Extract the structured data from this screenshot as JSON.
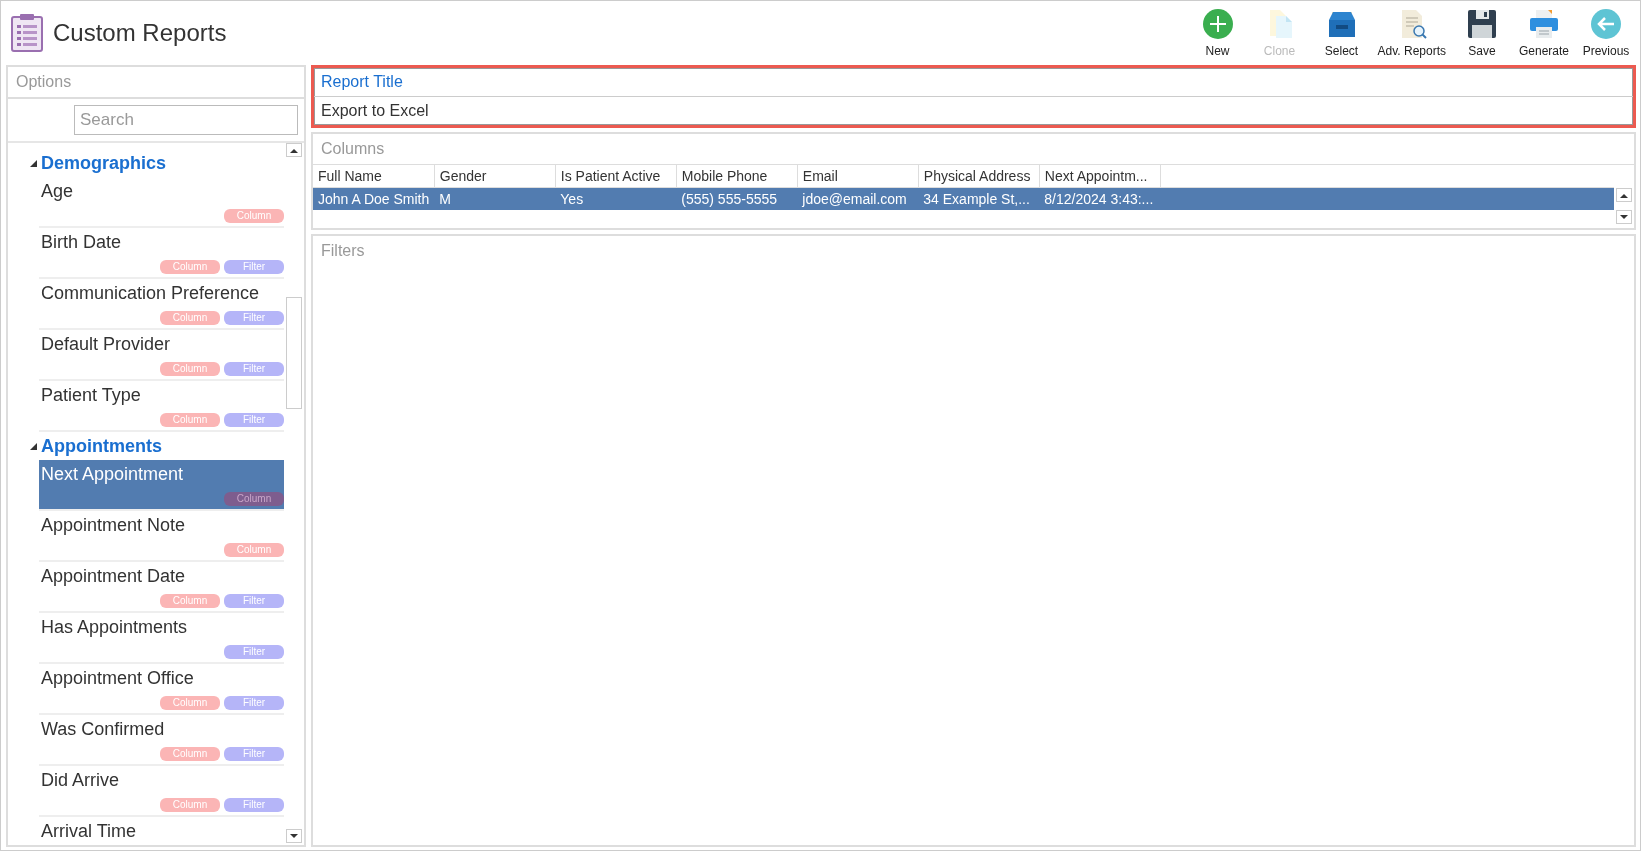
{
  "window": {
    "title": "Custom Reports"
  },
  "toolbar": [
    {
      "label": "New",
      "disabled": false
    },
    {
      "label": "Clone",
      "disabled": true
    },
    {
      "label": "Select",
      "disabled": false
    },
    {
      "label": "Adv. Reports",
      "disabled": false
    },
    {
      "label": "Save",
      "disabled": false
    },
    {
      "label": "Generate",
      "disabled": false
    },
    {
      "label": "Previous",
      "disabled": false
    }
  ],
  "sidebar": {
    "title": "Options",
    "search": {
      "placeholder": "Search"
    },
    "groups": [
      {
        "name": "Demographics",
        "expanded": true,
        "items": [
          {
            "name": "Age",
            "selected": false,
            "tags": [
              {
                "kind": "column",
                "label": "Column"
              }
            ]
          },
          {
            "name": "Birth Date",
            "selected": false,
            "tags": [
              {
                "kind": "column",
                "label": "Column"
              },
              {
                "kind": "filter",
                "label": "Filter"
              }
            ]
          },
          {
            "name": "Communication Preference",
            "selected": false,
            "tags": [
              {
                "kind": "column",
                "label": "Column"
              },
              {
                "kind": "filter",
                "label": "Filter"
              }
            ]
          },
          {
            "name": "Default Provider",
            "selected": false,
            "tags": [
              {
                "kind": "column",
                "label": "Column"
              },
              {
                "kind": "filter",
                "label": "Filter"
              }
            ]
          },
          {
            "name": "Patient Type",
            "selected": false,
            "tags": [
              {
                "kind": "column",
                "label": "Column"
              },
              {
                "kind": "filter",
                "label": "Filter"
              }
            ]
          }
        ]
      },
      {
        "name": "Appointments",
        "expanded": true,
        "items": [
          {
            "name": "Next Appointment",
            "selected": true,
            "tags": [
              {
                "kind": "column",
                "label": "Column"
              }
            ]
          },
          {
            "name": "Appointment Note",
            "selected": false,
            "tags": [
              {
                "kind": "column",
                "label": "Column"
              }
            ]
          },
          {
            "name": "Appointment Date",
            "selected": false,
            "tags": [
              {
                "kind": "column",
                "label": "Column"
              },
              {
                "kind": "filter",
                "label": "Filter"
              }
            ]
          },
          {
            "name": "Has Appointments",
            "selected": false,
            "tags": [
              {
                "kind": "filter",
                "label": "Filter"
              }
            ]
          },
          {
            "name": "Appointment Office",
            "selected": false,
            "tags": [
              {
                "kind": "column",
                "label": "Column"
              },
              {
                "kind": "filter",
                "label": "Filter"
              }
            ]
          },
          {
            "name": "Was Confirmed",
            "selected": false,
            "tags": [
              {
                "kind": "column",
                "label": "Column"
              },
              {
                "kind": "filter",
                "label": "Filter"
              }
            ]
          },
          {
            "name": "Did Arrive",
            "selected": false,
            "tags": [
              {
                "kind": "column",
                "label": "Column"
              },
              {
                "kind": "filter",
                "label": "Filter"
              }
            ]
          },
          {
            "name": "Arrival Time",
            "selected": false
          }
        ]
      }
    ]
  },
  "report": {
    "title": "Report Title",
    "export": "Export to Excel"
  },
  "columns_panel": {
    "title": "Columns",
    "table": {
      "columns": [
        "Full Name",
        "Gender",
        "Is Patient Active",
        "Mobile Phone",
        "Email",
        "Physical Address",
        "Next Appointm..."
      ],
      "rows": [
        {
          "selected": true,
          "cells": [
            "John A Doe Smith",
            "M",
            "Yes",
            "(555) 555-5555",
            "jdoe@email.com",
            "34 Example St,...",
            "8/12/2024 3:43:..."
          ]
        }
      ]
    }
  },
  "filters_panel": {
    "title": "Filters"
  }
}
